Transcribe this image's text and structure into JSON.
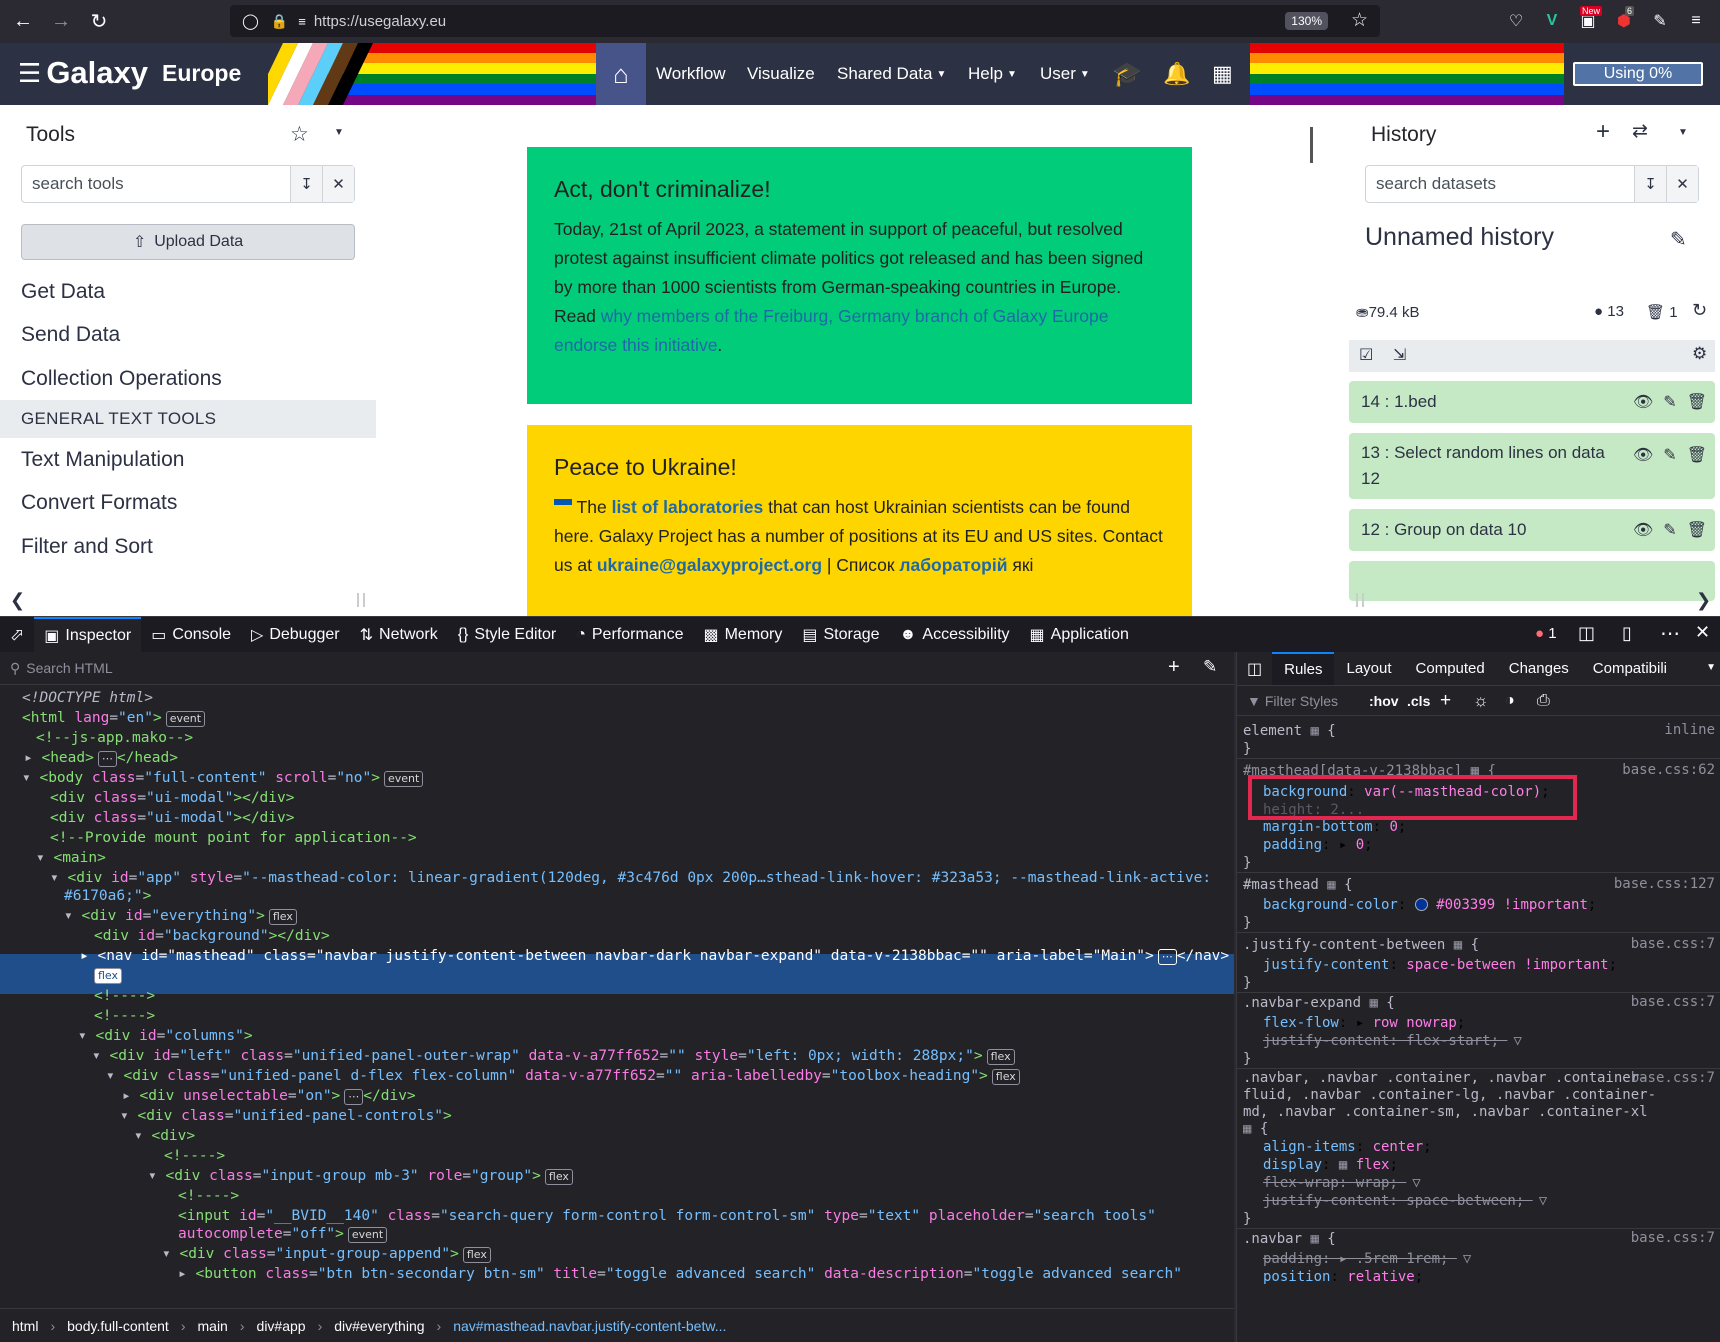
{
  "browser": {
    "url": "https://usegalaxy.eu",
    "zoom": "130%",
    "ext_badges": {
      "new": "New",
      "count": "6"
    }
  },
  "masthead": {
    "brand": "Galaxy",
    "brand_sub": "Europe",
    "nav": [
      "Workflow",
      "Visualize",
      "Shared Data",
      "Help",
      "User"
    ],
    "using": "Using 0%"
  },
  "tools_panel": {
    "title": "Tools",
    "search_placeholder": "search tools",
    "upload": "Upload Data",
    "items": [
      "Get Data",
      "Send Data",
      "Collection Operations"
    ],
    "section": "GENERAL TEXT TOOLS",
    "section_items": [
      "Text Manipulation",
      "Convert Formats",
      "Filter and Sort"
    ]
  },
  "banners": {
    "green_title": "Act, don't criminalize!",
    "green_text": "Today, 21st of April 2023, a statement in support of peaceful, but resolved protest against insufficient climate politics got released and has been signed by more than 1000 scientists from German-speaking countries in Europe. Read ",
    "green_link": "why members of the Freiburg, Germany branch of Galaxy Europe endorse this initiative",
    "green_end": ".",
    "yellow_title": "Peace to Ukraine!",
    "yellow_t1": " The ",
    "yellow_link1": "list of laboratories",
    "yellow_t2": " that can host Ukrainian scientists can be found here. Galaxy Project has a number of positions at its EU and US sites. Contact us at ",
    "yellow_link2": "ukraine@galaxyproject.org",
    "yellow_t3": " | Список ",
    "yellow_link3": "лабораторій",
    "yellow_t4": " які",
    "colors": {
      "green": "#00cc7a",
      "yellow": "#ffd500"
    }
  },
  "history": {
    "title": "History",
    "search_placeholder": "search datasets",
    "name": "Unnamed history",
    "size": "79.4 kB",
    "shown": "13",
    "deleted": "1",
    "items": [
      "14 : 1.bed",
      "13 : Select random lines on data 12",
      "12 : Group on data 10"
    ]
  },
  "devtools": {
    "tabs": [
      "Inspector",
      "Console",
      "Debugger",
      "Network",
      "Style Editor",
      "Performance",
      "Memory",
      "Storage",
      "Accessibility",
      "Application"
    ],
    "error_count": "1",
    "search_placeholder": "Search HTML",
    "rules_tabs": [
      "Rules",
      "Layout",
      "Computed",
      "Changes",
      "Compatibili"
    ],
    "filter_placeholder": "Filter Styles",
    "hov": ":hov",
    "cls": ".cls",
    "breadcrumbs": [
      "html",
      "body.full-content",
      "main",
      "div#app",
      "div#everything",
      "nav#masthead.navbar.justify-content-betw..."
    ],
    "badges": {
      "event": "event",
      "flex": "flex"
    }
  }
}
